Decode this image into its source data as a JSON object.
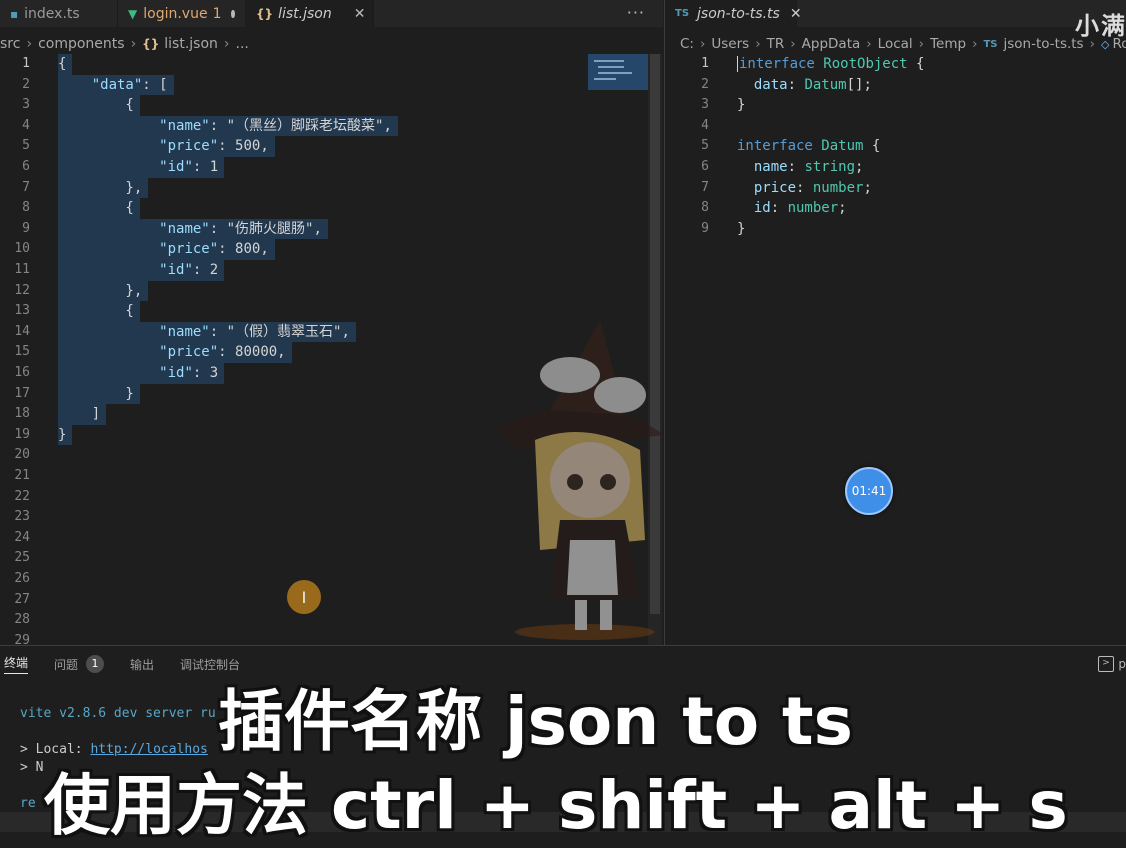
{
  "left_tabs": [
    {
      "label": "index.ts",
      "icon": "ts-icon",
      "state": "inactive"
    },
    {
      "label": "login.vue",
      "badge": "1",
      "icon": "vue-icon",
      "state": "modified"
    },
    {
      "label": "list.json",
      "icon": "json-icon",
      "state": "active"
    }
  ],
  "left_breadcrumb": {
    "p1": "src",
    "p2": "components",
    "p3": "list.json",
    "p4": "..."
  },
  "right_tab": {
    "badge": "TS",
    "label": "json-to-ts.ts"
  },
  "right_breadcrumb": {
    "p1": "C:",
    "p2": "Users",
    "p3": "TR",
    "p4": "AppData",
    "p5": "Local",
    "p6": "Temp",
    "p7": "json-to-ts.ts",
    "p8": "Roo"
  },
  "watermark": "小满",
  "json_lines": [
    [
      "1",
      "{"
    ],
    [
      "2",
      "    \"data\": ["
    ],
    [
      "3",
      "        {"
    ],
    [
      "4",
      "            \"name\": \"（黑丝）脚踩老坛酸菜\","
    ],
    [
      "5",
      "            \"price\": 500,"
    ],
    [
      "6",
      "            \"id\": 1"
    ],
    [
      "7",
      "        },"
    ],
    [
      "8",
      "        {"
    ],
    [
      "9",
      "            \"name\": \"伤肺火腿肠\","
    ],
    [
      "10",
      "            \"price\": 800,"
    ],
    [
      "11",
      "            \"id\": 2"
    ],
    [
      "12",
      "        },"
    ],
    [
      "13",
      "        {"
    ],
    [
      "14",
      "            \"name\": \"（假）翡翠玉石\","
    ],
    [
      "15",
      "            \"price\": 80000,"
    ],
    [
      "16",
      "            \"id\": 3"
    ],
    [
      "17",
      "        }"
    ],
    [
      "18",
      "    ]"
    ],
    [
      "19",
      "}"
    ],
    [
      "20",
      ""
    ],
    [
      "21",
      ""
    ],
    [
      "22",
      ""
    ],
    [
      "23",
      ""
    ],
    [
      "24",
      ""
    ],
    [
      "25",
      ""
    ],
    [
      "26",
      ""
    ],
    [
      "27",
      ""
    ],
    [
      "28",
      ""
    ],
    [
      "29",
      ""
    ]
  ],
  "ts_lines": [
    [
      "1",
      "interface RootObject {"
    ],
    [
      "2",
      "  data: Datum[];"
    ],
    [
      "3",
      "}"
    ],
    [
      "4",
      ""
    ],
    [
      "5",
      "interface Datum {"
    ],
    [
      "6",
      "  name: string;"
    ],
    [
      "7",
      "  price: number;"
    ],
    [
      "8",
      "  id: number;"
    ],
    [
      "9",
      "}"
    ]
  ],
  "timer": "01:41",
  "cursor_glyph": "I",
  "panel": {
    "tabs": [
      {
        "label": "终端",
        "active": true
      },
      {
        "label": "问题",
        "badge": "1"
      },
      {
        "label": "输出"
      },
      {
        "label": "调试控制台"
      }
    ],
    "right_label": "p",
    "terminal": {
      "line1": "vite v2.8.6 dev server ru",
      "line2_prefix": "> Local: ",
      "line2_link": "http://localhos",
      "line3": "> N",
      "line4": "re"
    }
  },
  "captions": {
    "line1": "插件名称 json to ts",
    "line2": "使用方法 ctrl + shift + alt + s"
  },
  "colors": {
    "accent": "#264f78",
    "timer": "#3f8fe8"
  }
}
